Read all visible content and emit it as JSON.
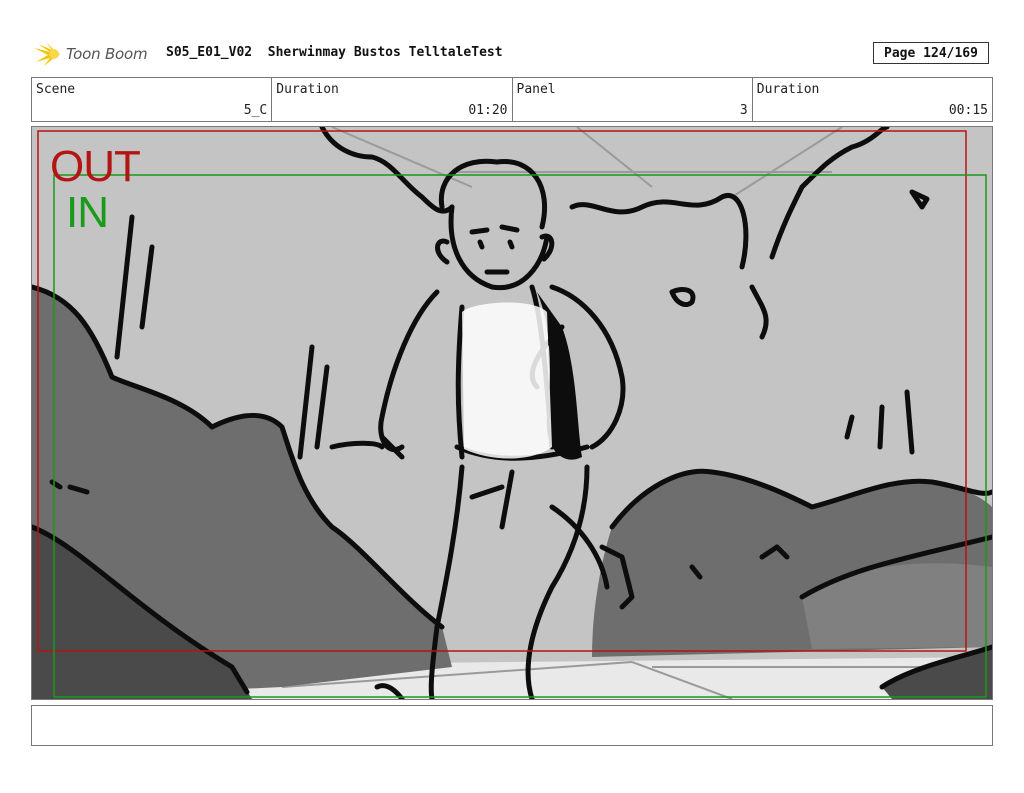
{
  "header": {
    "logo_text": "Toon Boom",
    "project": "S05_E01_V02  Sherwinmay Bustos TelltaleTest",
    "page": "Page 124/169"
  },
  "info": [
    {
      "label": "Scene",
      "value": "5_C"
    },
    {
      "label": "Duration",
      "value": "01:20"
    },
    {
      "label": "Panel",
      "value": "3"
    },
    {
      "label": "Duration",
      "value": "00:15"
    }
  ],
  "frame_labels": {
    "out": "OUT",
    "in": "IN"
  },
  "colors": {
    "out_frame": "#b31414",
    "in_frame": "#1a9a1a",
    "bg_gray": "#c4c4c4",
    "bush_dark": "#6e6e6e",
    "bush_mid": "#8a8a8a"
  },
  "notes": ""
}
